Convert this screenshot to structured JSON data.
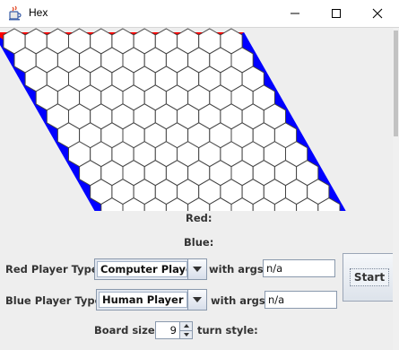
{
  "window": {
    "title": "Hex",
    "app_icon": "java-cup-icon",
    "controls": [
      "minimize-icon",
      "maximize-icon",
      "close-icon"
    ]
  },
  "board": {
    "size": 11,
    "red_color": "#ff0000",
    "blue_color": "#0000ff",
    "cell_color": "#ffffff",
    "cell_border": "#444444"
  },
  "status": {
    "red_label": "Red:",
    "blue_label": "Blue:"
  },
  "controls": {
    "red_player_type_label": "Red Player Type:",
    "red_player_type": "Computer Player",
    "red_args_label": "with args:",
    "red_args": "n/a",
    "blue_player_type_label": "Blue Player Type:",
    "blue_player_type": "Human Player",
    "blue_args_label": "with args:",
    "blue_args": "n/a",
    "start_label": "Start",
    "board_size_label": "Board size:",
    "board_size": "9",
    "turn_style_label": "turn style:"
  }
}
